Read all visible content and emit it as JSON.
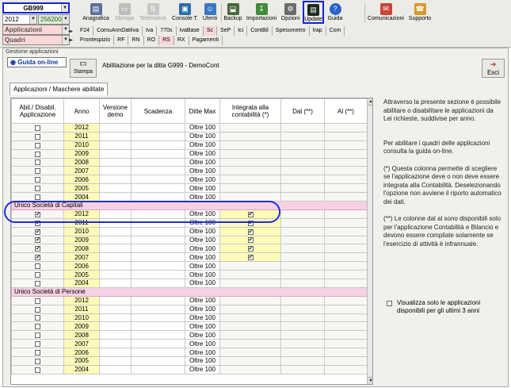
{
  "toolbar": {
    "company_combo": "GB999",
    "year_combo": "2012",
    "code_combo": "256200 -",
    "applicazioni_combo": "Applicazioni",
    "quadri_combo": "Quadri",
    "buttons": [
      {
        "label": "Anagrafica",
        "icon": "address-book-icon"
      },
      {
        "label": "Stampa",
        "icon": "printer-icon"
      },
      {
        "label": "Telematico",
        "icon": "telematic-icon"
      },
      {
        "label": "Console T.",
        "icon": "console-icon"
      },
      {
        "label": "Utenti",
        "icon": "users-icon"
      },
      {
        "label": "Backup",
        "icon": "backup-icon"
      },
      {
        "label": "Importazioni",
        "icon": "import-icon"
      },
      {
        "label": "Opzioni",
        "icon": "options-icon"
      },
      {
        "label": "Update",
        "icon": "update-icon"
      },
      {
        "label": "Guida",
        "icon": "help-icon"
      },
      {
        "label": "Comunicazioni",
        "icon": "communications-icon"
      },
      {
        "label": "Supporto",
        "icon": "support-icon"
      }
    ],
    "app_tabs": [
      "F24",
      "ComuAnnDatiIva",
      "Iva",
      "770s",
      "IvaBase",
      "Sc",
      "SeP",
      "Ici",
      "ContBil",
      "Spesometro",
      "Irap",
      "Com"
    ],
    "quadri_tabs": [
      "Frontespizio",
      "RF",
      "RN",
      "RO",
      "RS",
      "RX",
      "Pagamenti"
    ]
  },
  "panel": {
    "title": "Gestione applicazioni",
    "guida_online": "Guida on-line",
    "stampa": "Stampa",
    "abilitazione": "Abilitazione per la ditta G999 -  DemoCont",
    "esci": "Esci",
    "tab": "Applicazioni / Maschere abilitate"
  },
  "table": {
    "headers": [
      "Abil./ Disabil. Applicazione",
      "Anno",
      "Versione demo",
      "Scadenza",
      "Ditte Max",
      "Integrata alla contabilità (*)",
      "Dal (**)",
      "Al (**)"
    ],
    "groups": [
      {
        "name": "",
        "rows": [
          {
            "anno": "2012",
            "abil": false,
            "ditte": "Oltre 100",
            "integrata": false
          },
          {
            "anno": "2011",
            "abil": false,
            "ditte": "Oltre 100",
            "integrata": false
          },
          {
            "anno": "2010",
            "abil": false,
            "ditte": "Oltre 100",
            "integrata": false
          },
          {
            "anno": "2009",
            "abil": false,
            "ditte": "Oltre 100",
            "integrata": false
          },
          {
            "anno": "2008",
            "abil": false,
            "ditte": "Oltre 100",
            "integrata": false
          },
          {
            "anno": "2007",
            "abil": false,
            "ditte": "Oltre 100",
            "integrata": false
          },
          {
            "anno": "2006",
            "abil": false,
            "ditte": "Oltre 100",
            "integrata": false
          },
          {
            "anno": "2005",
            "abil": false,
            "ditte": "Oltre 100",
            "integrata": false
          },
          {
            "anno": "2004",
            "abil": false,
            "ditte": "Oltre 100",
            "integrata": false
          }
        ]
      },
      {
        "name": "Unico Società di Capitali",
        "rows": [
          {
            "anno": "2012",
            "abil": true,
            "ditte": "Oltre 100",
            "integrata": true
          },
          {
            "anno": "2011",
            "abil": true,
            "ditte": "Oltre 100",
            "integrata": true
          },
          {
            "anno": "2010",
            "abil": true,
            "ditte": "Oltre 100",
            "integrata": true
          },
          {
            "anno": "2009",
            "abil": true,
            "ditte": "Oltre 100",
            "integrata": true
          },
          {
            "anno": "2008",
            "abil": true,
            "ditte": "Oltre 100",
            "integrata": true
          },
          {
            "anno": "2007",
            "abil": true,
            "ditte": "Oltre 100",
            "integrata": true
          },
          {
            "anno": "2006",
            "abil": false,
            "ditte": "Oltre 100",
            "integrata": false
          },
          {
            "anno": "2005",
            "abil": false,
            "ditte": "Oltre 100",
            "integrata": false
          },
          {
            "anno": "2004",
            "abil": false,
            "ditte": "Oltre 100",
            "integrata": false
          }
        ]
      },
      {
        "name": "Unico Società di Persone",
        "rows": [
          {
            "anno": "2012",
            "abil": false,
            "ditte": "Oltre 100",
            "integrata": false
          },
          {
            "anno": "2011",
            "abil": false,
            "ditte": "Oltre 100",
            "integrata": false
          },
          {
            "anno": "2010",
            "abil": false,
            "ditte": "Oltre 100",
            "integrata": false
          },
          {
            "anno": "2009",
            "abil": false,
            "ditte": "Oltre 100",
            "integrata": false
          },
          {
            "anno": "2008",
            "abil": false,
            "ditte": "Oltre 100",
            "integrata": false
          },
          {
            "anno": "2007",
            "abil": false,
            "ditte": "Oltre 100",
            "integrata": false
          },
          {
            "anno": "2006",
            "abil": false,
            "ditte": "Oltre 100",
            "integrata": false
          },
          {
            "anno": "2005",
            "abil": false,
            "ditte": "Oltre 100",
            "integrata": false
          },
          {
            "anno": "2004",
            "abil": false,
            "ditte": "Oltre 100",
            "integrata": false
          }
        ]
      }
    ]
  },
  "help": {
    "p1": "Attraverso la presente sezione è possibile abilitare o disabilitare le applicazioni da Lei richieste, suddivise per anno.",
    "p2": "Per abilitare i quadri delle applicazioni consulta la guida on-line.",
    "p3": "(*) Questa colonna permette di scegliere se l'applicazione deve o non deve essere integrata alla Contabilità. Deselezionando l'opzione non avviene il riporto automatico dei dati.",
    "p4": "(**) Le colonne dal al sono disponibili solo per l'applicazione Contabilità e Bilancio e devono essere compilate solamente se l'esercizio di attività è infrannuale.",
    "visualizza": "Visualizza solo le applicazioni disponibili per gli ultimi 3 anni"
  },
  "colors": {
    "year_bg": "#fdfbb8",
    "group_bg": "#f6d0e4",
    "highlight": "#1f2fd6"
  }
}
